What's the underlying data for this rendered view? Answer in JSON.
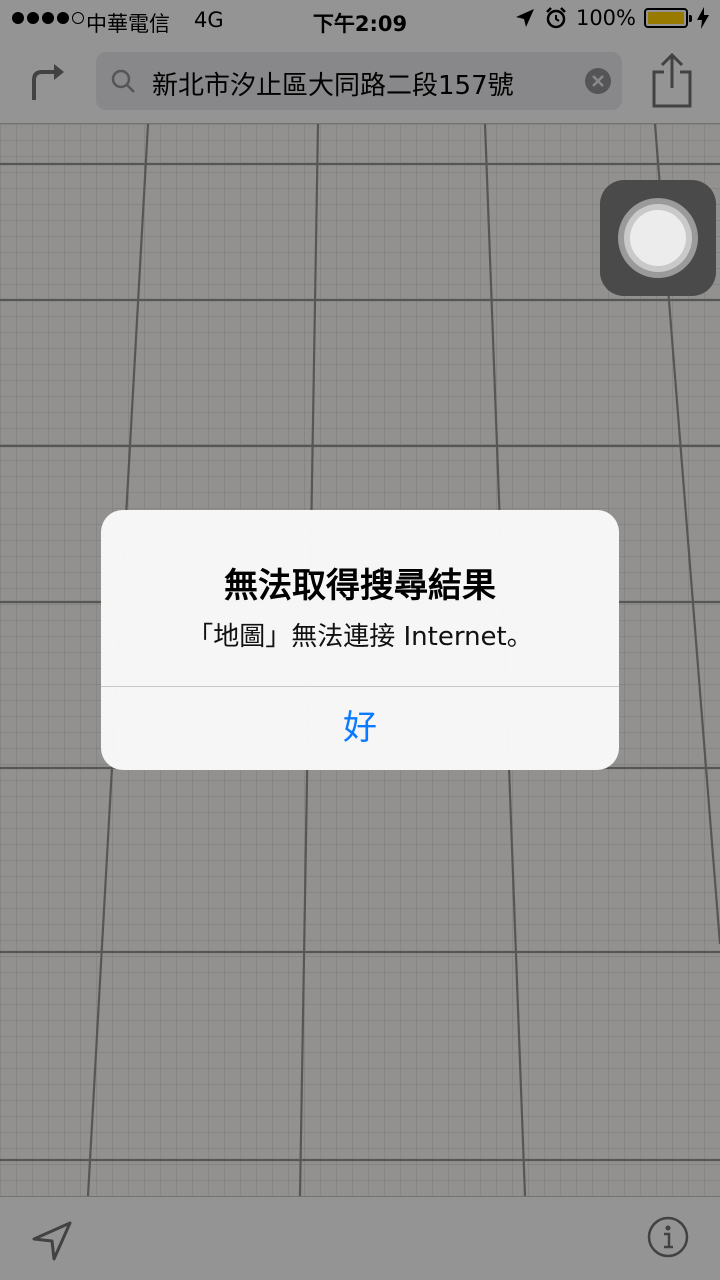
{
  "status_bar": {
    "carrier": "中華電信",
    "network": "4G",
    "time": "下午2:09",
    "battery": "100%"
  },
  "top_bar": {
    "search_text": "新北市汐止區大同路二段157號"
  },
  "alert": {
    "title": "無法取得搜尋結果",
    "message": "「地圖」無法連接 Internet。",
    "ok_label": "好"
  },
  "colors": {
    "accent": "#0A7AFF",
    "battery": "#FFCC00"
  }
}
